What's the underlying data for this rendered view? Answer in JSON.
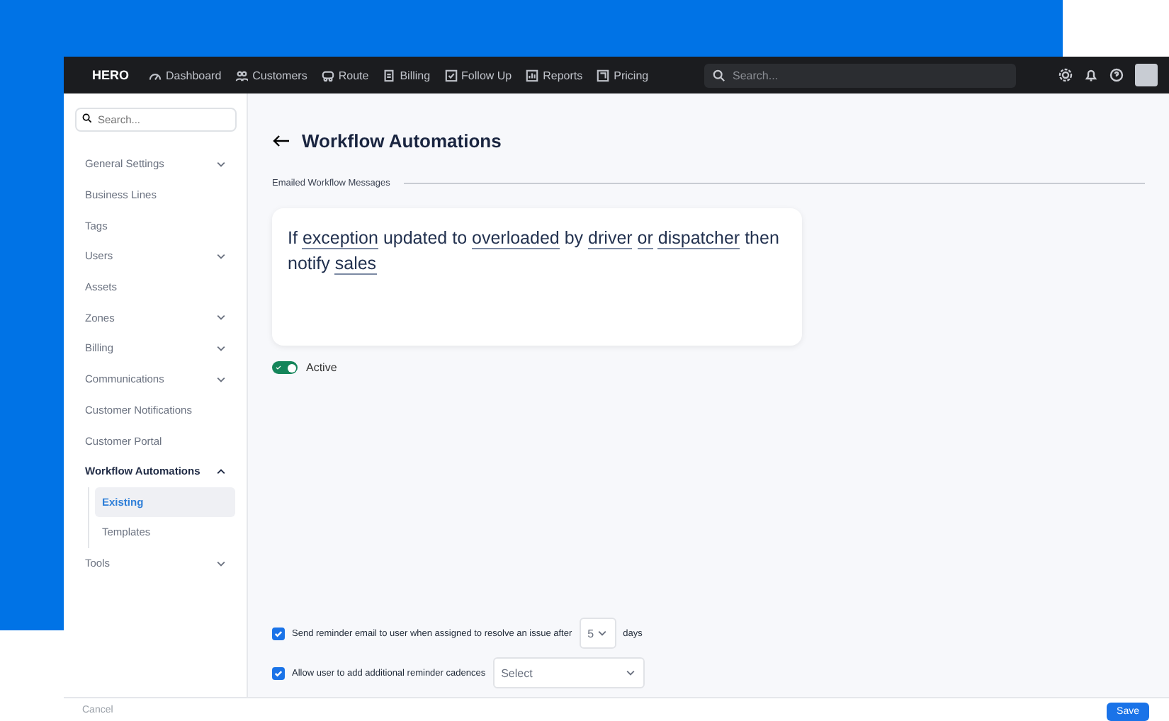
{
  "nav": {
    "logo": "HERO",
    "items": [
      {
        "label": "Dashboard"
      },
      {
        "label": "Customers"
      },
      {
        "label": "Route"
      },
      {
        "label": "Billing"
      },
      {
        "label": "Follow Up"
      },
      {
        "label": "Reports"
      },
      {
        "label": "Pricing"
      }
    ],
    "search": {
      "placeholder": "Search..."
    }
  },
  "sidebar": {
    "search": {
      "placeholder": "Search..."
    },
    "items": [
      {
        "label": "General Settings",
        "expanded": false
      },
      {
        "label": "Business Lines"
      },
      {
        "label": "Tags"
      },
      {
        "label": "Users",
        "expanded": false
      },
      {
        "label": "Assets"
      },
      {
        "label": "Zones",
        "expanded": false
      },
      {
        "label": "Billing",
        "expanded": false
      },
      {
        "label": "Communications",
        "expanded": false
      },
      {
        "label": "Customer Notifications"
      },
      {
        "label": "Customer Portal"
      },
      {
        "label": "Workflow Automations",
        "expanded": true,
        "children": [
          {
            "label": "Existing",
            "selected": true
          },
          {
            "label": "Templates",
            "selected": false
          }
        ]
      },
      {
        "label": "Tools",
        "expanded": false
      }
    ]
  },
  "page": {
    "title": "Workflow Automations",
    "section": "Emailed Workflow Messages",
    "rule": [
      {
        "text": "If",
        "linked": false
      },
      {
        "text": "exception",
        "linked": true
      },
      {
        "text": "updated to",
        "linked": false
      },
      {
        "text": "overloaded",
        "linked": true
      },
      {
        "text": "by",
        "linked": false
      },
      {
        "text": "driver",
        "linked": true
      },
      {
        "text": "or",
        "linked": true
      },
      {
        "text": "dispatcher",
        "linked": true
      },
      {
        "text": "then notify",
        "linked": false
      },
      {
        "text": "sales",
        "linked": true
      }
    ],
    "active": {
      "label": "Active",
      "on": true
    },
    "options": [
      {
        "label": "Send reminder email to user when assigned to resolve an issue after",
        "checked": true,
        "kind": "number",
        "value": "5",
        "suffix": "days"
      },
      {
        "label": "Allow user to add additional reminder cadences",
        "checked": true,
        "kind": "select",
        "placeholder": "Select"
      }
    ]
  },
  "footer": {
    "cancel": "Cancel",
    "save": "Save"
  }
}
